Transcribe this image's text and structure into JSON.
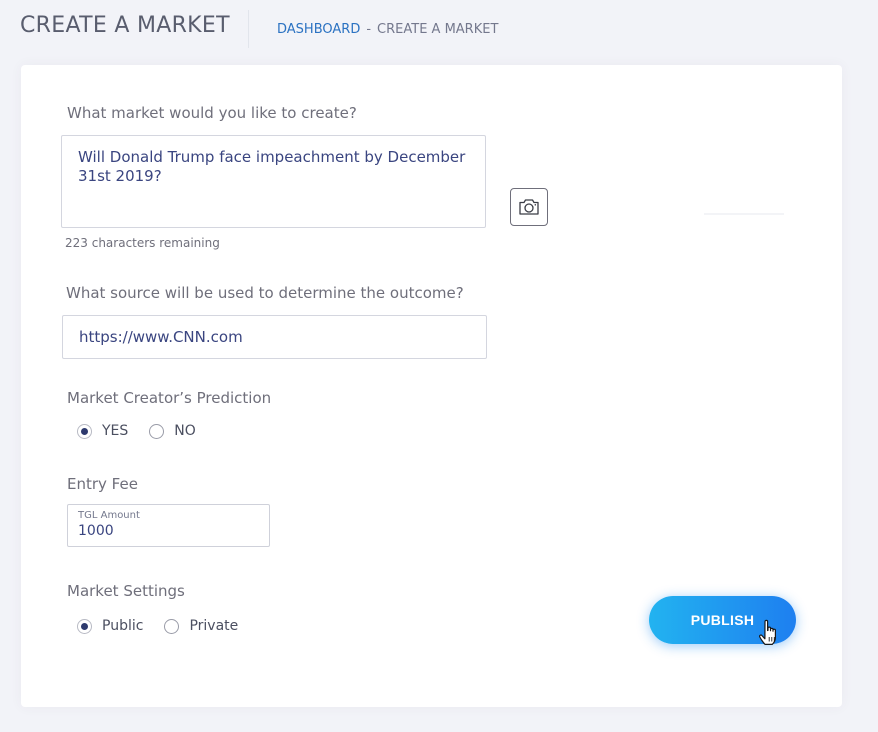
{
  "header": {
    "title": "CREATE A MARKET",
    "breadcrumb": {
      "link": "DASHBOARD",
      "separator": "-",
      "current": "CREATE A MARKET"
    }
  },
  "form": {
    "question_label": "What market would you like to create?",
    "question_value": "Will Donald Trump face impeachment by December 31st 2019?",
    "characters_remaining": "223 characters remaining",
    "camera_icon": "camera-icon",
    "source_label": "What source will be used to determine the outcome?",
    "source_value": "https://www.CNN.com",
    "prediction_label": "Market Creator’s Prediction",
    "prediction_options": [
      {
        "label": "YES",
        "selected": true
      },
      {
        "label": "NO",
        "selected": false
      }
    ],
    "entry_fee_label": "Entry Fee",
    "entry_fee_field_label": "TGL Amount",
    "entry_fee_value": "1000",
    "settings_label": "Market Settings",
    "settings_options": [
      {
        "label": "Public",
        "selected": true
      },
      {
        "label": "Private",
        "selected": false
      }
    ],
    "publish_label": "PUBLISH",
    "cursor_icon": "hand-pointer-icon"
  },
  "colors": {
    "background": "#f2f3f8",
    "card": "#ffffff",
    "accent_link": "#2b72c2",
    "button_gradient_start": "#22b3f0",
    "button_gradient_end": "#1e7ff0",
    "input_text": "#3a4580"
  }
}
